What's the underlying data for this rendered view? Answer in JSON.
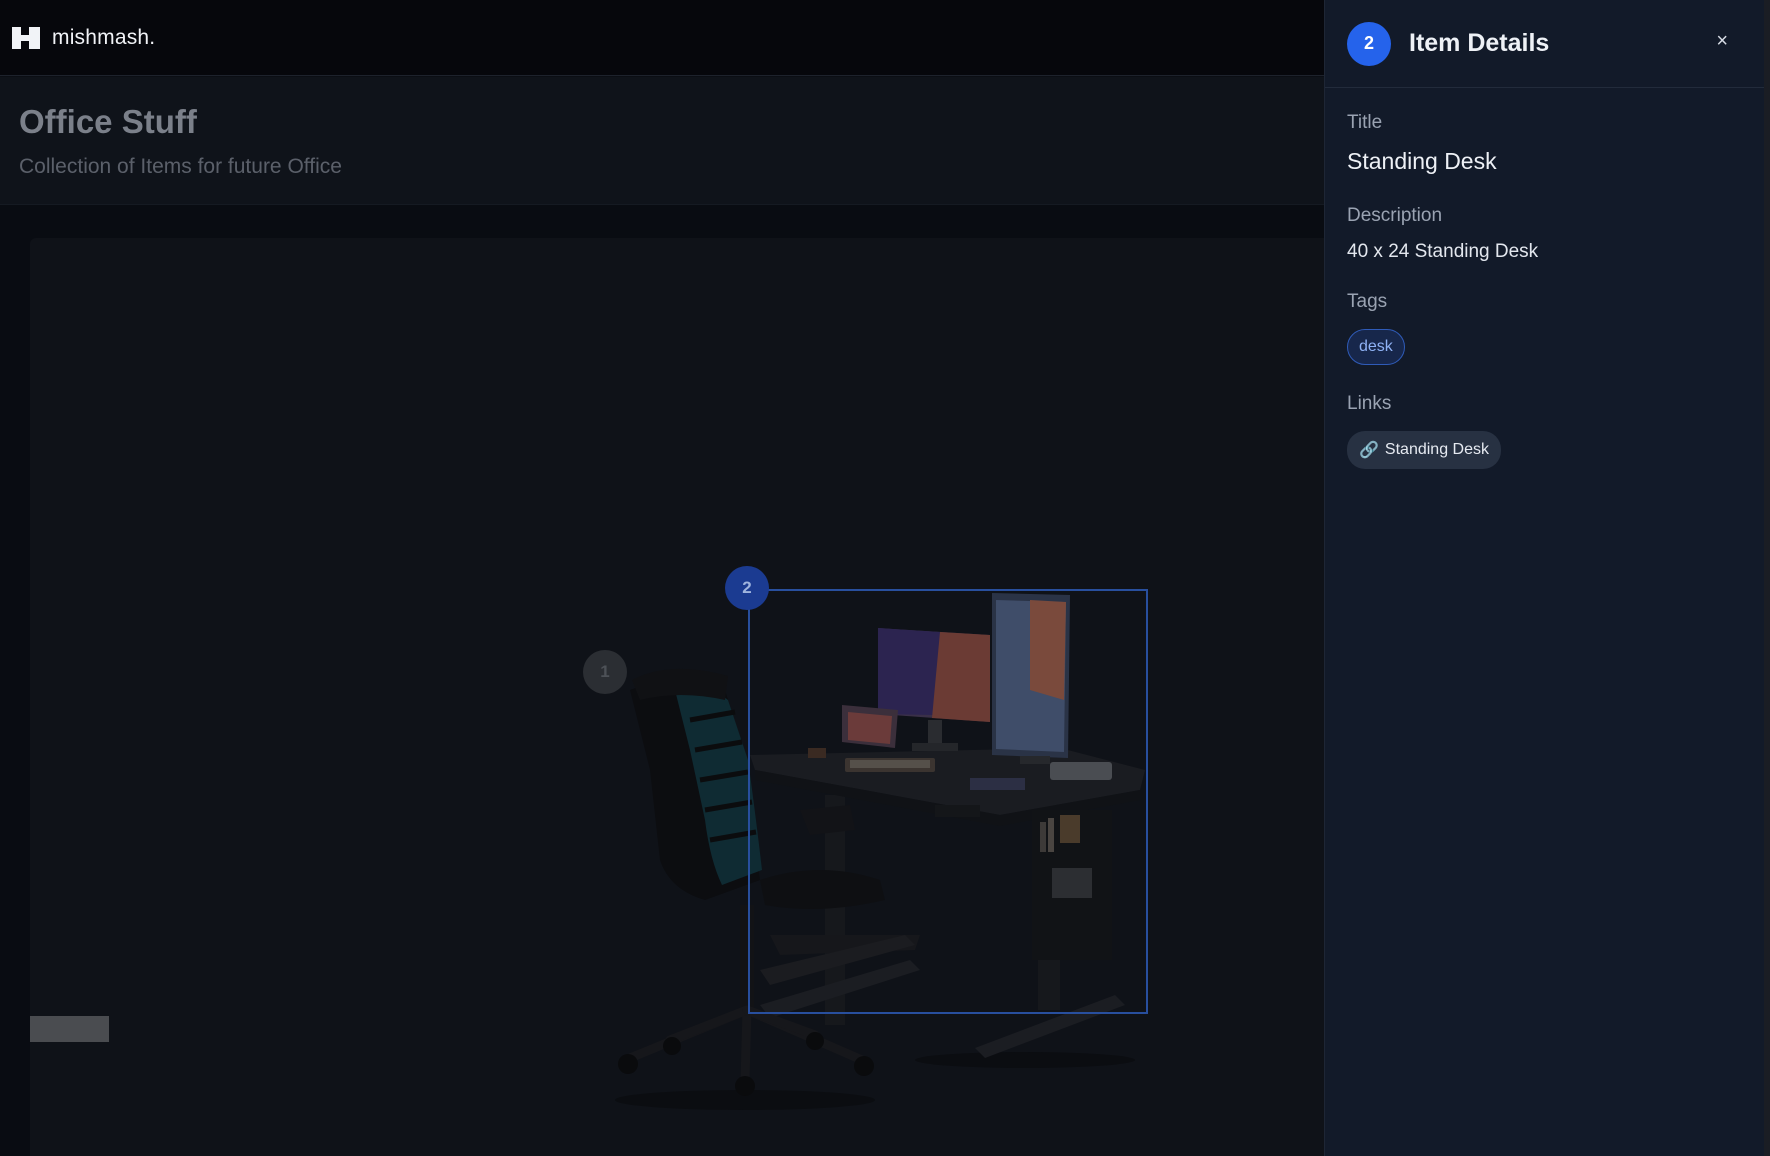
{
  "app": {
    "brand": "mishmash.",
    "logo_icon": "logo-icon"
  },
  "page": {
    "title": "Office Stuff",
    "subtitle": "Collection of Items for future Office"
  },
  "canvas": {
    "markers": [
      {
        "number": "1",
        "state": "inactive"
      },
      {
        "number": "2",
        "state": "selected"
      }
    ]
  },
  "panel": {
    "badge": "2",
    "title": "Item Details",
    "close": "×",
    "title_label": "Title",
    "title_value": "Standing Desk",
    "description_label": "Description",
    "description_value": "40 x 24 Standing Desk",
    "tags_label": "Tags",
    "tags": [
      "desk"
    ],
    "links_label": "Links",
    "links": [
      {
        "icon": "link-icon",
        "label": "Standing Desk"
      }
    ]
  },
  "colors": {
    "accent": "#2563eb",
    "panel_bg": "#121a29",
    "app_bg": "#0b0e14"
  }
}
